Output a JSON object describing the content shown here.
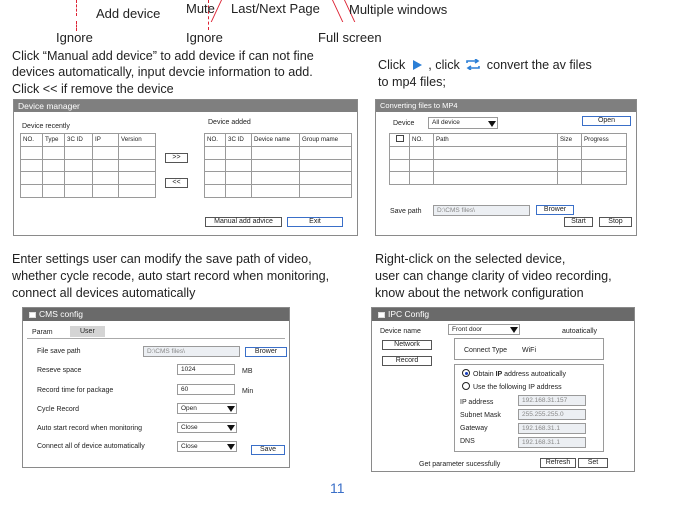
{
  "callouts": {
    "add_device": "Add device",
    "mute": "Mute",
    "last_next_page": "Last/Next Page",
    "multiple_windows": "Multiple windows",
    "ignore_1": "Ignore",
    "ignore_2": "Ignore",
    "full_screen": "Full screen"
  },
  "instructions": {
    "manual_add": [
      "Click “Manual add device” to add device if can not fine",
      "devices automatically, input devcie information to add.",
      "Click << if remove the device"
    ],
    "convert_pre": "Click",
    "convert_mid": ",  click",
    "convert_post": "convert the av files",
    "convert_line2": "to mp4 files;",
    "settings": [
      "Enter settings user can modify the save path of video,",
      "whether cycle recode, auto start record when monitoring,",
      "connect all devices automatically"
    ],
    "right_click": [
      "Right-click on the selected device,",
      "user can change clarity of video recording,",
      "know about the network configuration"
    ]
  },
  "device_manager": {
    "title": "Device manager",
    "recent_label": "Device recently",
    "added_label": "Device added",
    "recent_columns": [
      "NO.",
      "Type",
      "3C ID",
      "IP",
      "Version"
    ],
    "added_columns": [
      "NO.",
      "3C ID",
      "Device name",
      "Group mame"
    ],
    "add_btn": ">>",
    "remove_btn": "<<",
    "manual_btn": "Manual add advice",
    "exit_btn": "Exit"
  },
  "converter": {
    "title": "Converting files to MP4",
    "device_label": "Device",
    "device_value": "All device",
    "open_btn": "Open",
    "columns": [
      "",
      "NO.",
      "Path",
      "Size",
      "Progress"
    ],
    "save_path_label": "Save path",
    "save_path_value": "D:\\CMS files\\",
    "browser_btn": "Brower",
    "start_btn": "Start",
    "stop_btn": "Stop"
  },
  "cms_config": {
    "title": "CMS config",
    "tabs": [
      "Param",
      "User"
    ],
    "file_save_path_label": "File save path",
    "file_save_path_value": "D:\\CMS files\\",
    "browser_btn": "Brower",
    "reserve_label": "Reseve space",
    "reserve_value": "1024",
    "reserve_unit": "MB",
    "record_time_label": "Record  time for package",
    "record_time_value": "60",
    "record_time_unit": "Min",
    "cycle_label": "Cycle Record",
    "cycle_value": "Open",
    "auto_start_label": "Auto start record when monitoring",
    "auto_start_value": "Close",
    "connect_all_label": "Connect all of device automatically",
    "connect_all_value": "Close",
    "save_btn": "Save"
  },
  "ipc_config": {
    "title": "IPC Config",
    "device_name_label": "Device name",
    "device_name_value": "Front door",
    "auto_text": "autoatically",
    "network_btn": "Network",
    "record_btn": "Record",
    "connect_type_label": "Connect Type",
    "connect_type_value": "WiFi",
    "obtain_ip_pre": "Obtain ",
    "obtain_ip_bold": "IP",
    "obtain_ip_post": " address autoatically",
    "use_ip": "Use the following IP address",
    "ip_label": "IP address",
    "ip_value": "192.168.31.157",
    "subnet_label": "Subnet Mask",
    "subnet_value": "255.255.255.0",
    "gateway_label": "Gateway",
    "gateway_value": "192.168.31.1",
    "dns_label": "DNS",
    "dns_value": "192.168.31.1",
    "status": "Get parameter sucessfully",
    "refresh_btn": "Refresh",
    "set_btn": "Set"
  },
  "page_number": "11",
  "colors": {
    "callout_line": "#dd2233",
    "play_icon": "#2b7fd6",
    "convert_icon": "#2b7fd6",
    "page_number": "#3a6fc8"
  }
}
